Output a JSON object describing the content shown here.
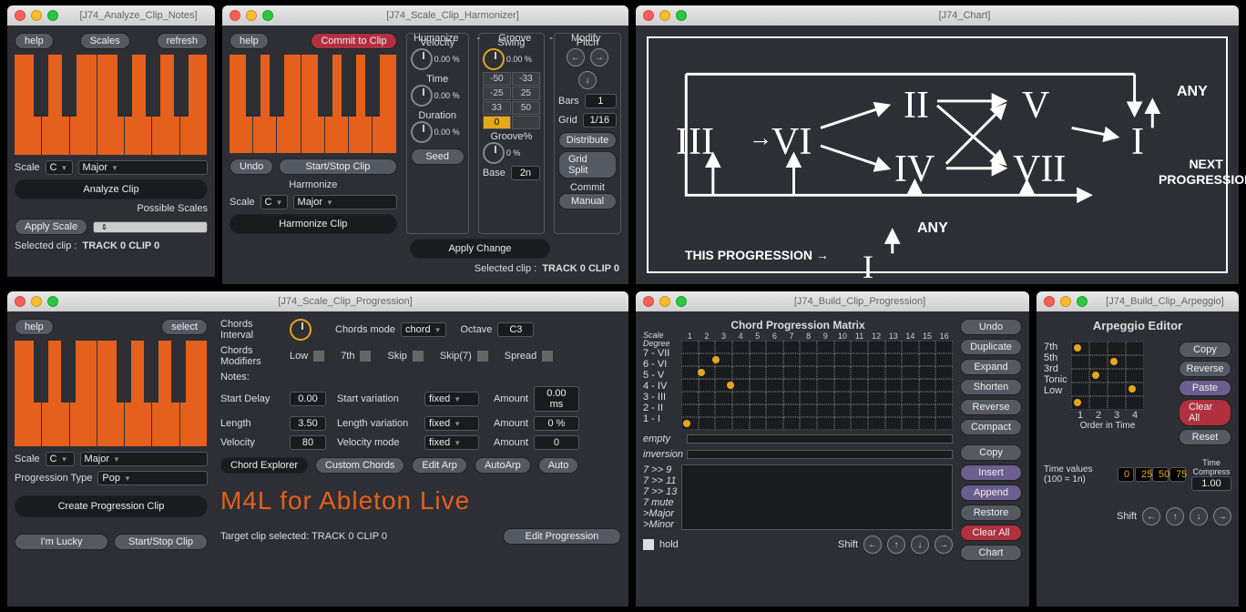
{
  "win1": {
    "title": "[J74_Analyze_Clip_Notes]",
    "help": "help",
    "scales": "Scales",
    "refresh": "refresh",
    "scale_lbl": "Scale",
    "root": "C",
    "mode": "Major",
    "analyze": "Analyze Clip",
    "possible": "Possible Scales",
    "apply": "Apply Scale",
    "selected": "Selected clip :",
    "selval": "TRACK 0 CLIP 0"
  },
  "win2": {
    "title": "[J74_Scale_Clip_Harmonizer]",
    "help": "help",
    "commit": "Commit to Clip",
    "humanize": "Humanize",
    "groove": "Groove",
    "modify": "Modify",
    "undo": "Undo",
    "startstop": "Start/Stop Clip",
    "harmonize_lbl": "Harmonize",
    "scale_lbl": "Scale",
    "root": "C",
    "mode": "Major",
    "harmonize_btn": "Harmonize Clip",
    "velocity": "Velocity",
    "velval": "0.00 %",
    "time": "Time",
    "timeval": "0.00 %",
    "duration": "Duration",
    "durval": "0.00 %",
    "seed": "Seed",
    "swing": "Swing",
    "swingval": "0.00 %",
    "grid": [
      "-50",
      "-33",
      "-25",
      "25",
      "33",
      "50",
      "0",
      ""
    ],
    "groovepct": "Groove%",
    "groovepctval": "0 %",
    "base": "Base",
    "baseval": "2n",
    "apply": "Apply Change",
    "pitch": "Pitch",
    "bars": "Bars",
    "barsval": "1",
    "gridl": "Grid",
    "gridval": "1/16",
    "distribute": "Distribute",
    "gridsplit": "Grid Split",
    "commit2": "Commit",
    "manual": "Manual",
    "selected": "Selected clip :",
    "selval": "TRACK 0 CLIP 0"
  },
  "win3": {
    "title": "[J74_Chart]",
    "romans": [
      "III",
      "VI",
      "II",
      "IV",
      "V",
      "VII",
      "I"
    ],
    "any": "ANY",
    "next": "NEXT PROGRESSION",
    "this": "THIS PROGRESSION"
  },
  "win4": {
    "title": "[J74_Scale_Clip_Progression]",
    "help": "help",
    "select": "select",
    "scale_lbl": "Scale",
    "root": "C",
    "mode": "Major",
    "progtype_lbl": "Progression Type",
    "progtype": "Pop",
    "create": "Create Progression Clip",
    "lucky": "I'm Lucky",
    "startstop": "Start/Stop Clip",
    "chords_interval": "Chords Interval",
    "chords_mode_lbl": "Chords mode",
    "chords_mode": "chord",
    "octave_lbl": "Octave",
    "octave": "C3",
    "modifiers": "Chords Modifiers",
    "low": "Low",
    "seventh": "7th",
    "skip": "Skip",
    "skip7": "Skip(7)",
    "spread": "Spread",
    "notes": "Notes:",
    "startdelay": "Start Delay",
    "startdelayval": "0.00",
    "length": "Length",
    "lengthval": "3.50",
    "velocity": "Velocity",
    "velocityval": "80",
    "startvar": "Start variation",
    "lengthvar": "Length variation",
    "velmode": "Velocity mode",
    "fixed": "fixed",
    "amount": "Amount",
    "amt1": "0.00 ms",
    "amt2": "0 %",
    "amt3": "0",
    "chordexp": "Chord Explorer",
    "custom": "Custom Chords",
    "editarp": "Edit Arp",
    "autoarp": "AutoArp",
    "auto": "Auto",
    "m4l": "M4L for Ableton Live",
    "target": "Target clip selected: TRACK 0 CLIP 0",
    "editprog": "Edit Progression"
  },
  "win5": {
    "title": "[J74_Build_Clip_Progression]",
    "matrix_title": "Chord Progression Matrix",
    "scale_degree": "Scale Degree",
    "degrees": [
      "7 - VII",
      "6 - VI",
      "5 - V",
      "4 - IV",
      "3 - III",
      "2 - II",
      "1 - I"
    ],
    "empty": "empty",
    "inversion": "inversion",
    "extra": [
      "7 >> 9",
      "7 >> 11",
      "7 >> 13",
      "7 mute",
      ">Major",
      ">Minor"
    ],
    "hold": "hold",
    "shift": "Shift",
    "btns": [
      "Undo",
      "Duplicate",
      "Expand",
      "Shorten",
      "Reverse",
      "Compact",
      "Copy",
      "Insert",
      "Append",
      "Restore",
      "Clear All",
      "Chart"
    ],
    "cols": [
      "1",
      "2",
      "3",
      "4",
      "5",
      "6",
      "7",
      "8",
      "9",
      "10",
      "11",
      "12",
      "13",
      "14",
      "15",
      "16"
    ]
  },
  "win6": {
    "title": "[J74_Build_Clip_Arpeggio]",
    "arp_title": "Arpeggio Editor",
    "rows": [
      "7th",
      "5th",
      "3rd",
      "Tonic",
      "Low"
    ],
    "order": "Order in Time",
    "cols": [
      "1",
      "2",
      "3",
      "4"
    ],
    "btns": [
      "Copy",
      "Reverse",
      "Paste",
      "Clear All",
      "Reset"
    ],
    "timevalues": "Time values",
    "timevalues2": "(100 = 1n)",
    "tv": [
      "0",
      "25",
      "50",
      "75"
    ],
    "timecompress": "Time Compress",
    "tcval": "1.00",
    "shift": "Shift"
  }
}
